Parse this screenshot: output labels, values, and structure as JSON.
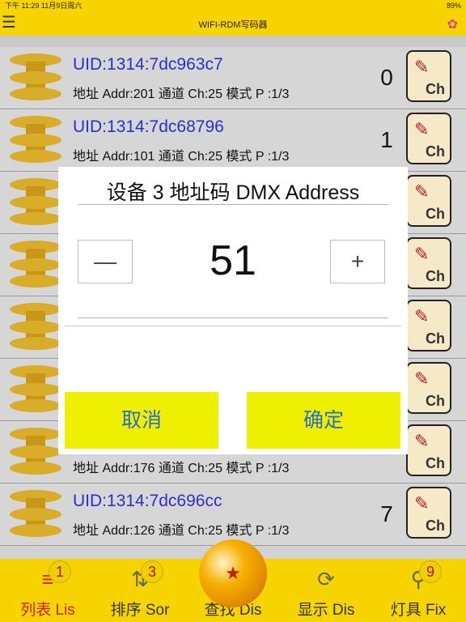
{
  "status": {
    "time": "下午 11:29   11月9日周六",
    "battery": "89%"
  },
  "header": {
    "title": "WIFI-RDM写码器",
    "menu_icon": "menu-icon",
    "gem_icon": "gem-icon"
  },
  "rows": [
    {
      "uid": "UID:1314:7dc963c7",
      "info": "地址 Addr:201  通道 Ch:25  模式 P :1/3",
      "index": "0",
      "btn": "Ch"
    },
    {
      "uid": "UID:1314:7dc68796",
      "info": "地址 Addr:101  通道 Ch:25  模式 P :1/3",
      "index": "1",
      "btn": "Ch"
    },
    {
      "uid": "",
      "info": "",
      "index": "",
      "btn": "Ch"
    },
    {
      "uid": "",
      "info": "",
      "index": "",
      "btn": "Ch"
    },
    {
      "uid": "",
      "info": "",
      "index": "",
      "btn": "Ch"
    },
    {
      "uid": "",
      "info": "",
      "index": "",
      "btn": "Ch"
    },
    {
      "uid": "",
      "info": "地址 Addr:176  通道 Ch:25  模式 P :1/3",
      "index": "",
      "btn": "Ch"
    },
    {
      "uid": "UID:1314:7dc696cc",
      "info": "地址 Addr:126  通道 Ch:25  模式 P :1/3",
      "index": "7",
      "btn": "Ch"
    }
  ],
  "dialog": {
    "title": "设备 3 地址码 DMX Address",
    "value": "51",
    "minus": "—",
    "plus": "+",
    "cancel": "取消",
    "confirm": "确定"
  },
  "tabs": [
    {
      "label": "列表 Lis",
      "badge": "1",
      "icon": "list-icon",
      "active": true
    },
    {
      "label": "排序 Sor",
      "badge": "3",
      "icon": "sort-icon",
      "active": false
    },
    {
      "label": "查找 Dis",
      "badge": "",
      "icon": "dragonball-icon",
      "active": false
    },
    {
      "label": "显示 Dis",
      "badge": "",
      "icon": "refresh-icon",
      "active": false
    },
    {
      "label": "灯具 Fix",
      "badge": "9",
      "icon": "fixture-icon",
      "active": false
    }
  ]
}
